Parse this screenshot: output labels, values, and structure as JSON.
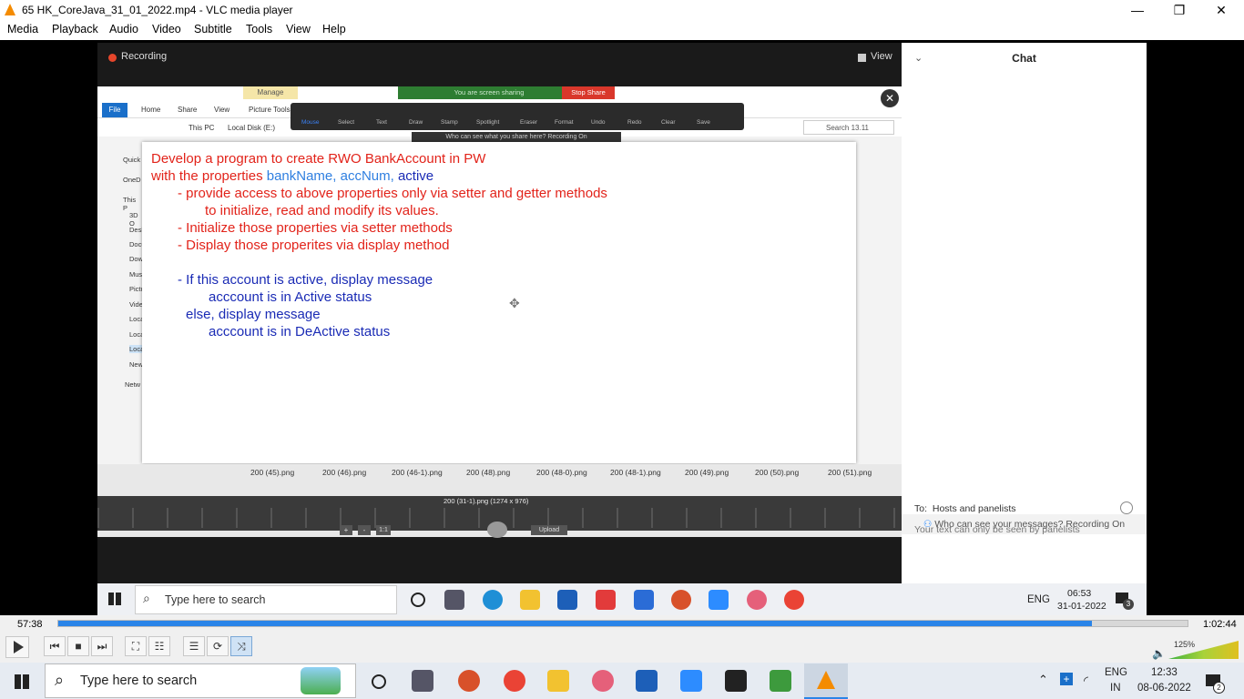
{
  "window": {
    "title": "65 HK_CoreJava_31_01_2022.mp4 - VLC media player",
    "minimize": "—",
    "restore": "❐",
    "close": "✕"
  },
  "menu": [
    "Media",
    "Playback",
    "Audio",
    "Video",
    "Subtitle",
    "Tools",
    "View",
    "Help"
  ],
  "zoom": {
    "recording": "Recording",
    "view": "View",
    "share_status": "You are screen sharing",
    "stop_share": "Stop Share",
    "who_sees": "Who can see what you share here? Recording On",
    "explorer_tabs": [
      "File",
      "Home",
      "Share",
      "View",
      "Picture Tools"
    ],
    "manage": "Manage",
    "path": [
      "This PC",
      "Local Disk (E:)"
    ],
    "search": "Search 13.11",
    "annot_tools": [
      "Mouse",
      "Select",
      "Text",
      "Draw",
      "Stamp",
      "Spotlight",
      "Eraser",
      "Format",
      "Undo",
      "Redo",
      "Clear",
      "Save"
    ],
    "nav_items": [
      "Quick",
      "OneD",
      "This P",
      "3D O",
      "Desk",
      "Docu",
      "Down",
      "Musi",
      "Pictu",
      "Vide",
      "Loca",
      "Loca",
      "Loca",
      "New",
      "Netw"
    ]
  },
  "slide": {
    "line1": "Develop a program to create RWO BankAccount in PW",
    "line2_prefix": "with the properties ",
    "line2_props_a": "bankName, accNum,",
    "line2_props_b": " active",
    "line3": "- provide access to above properties only via setter and getter methods",
    "line4": "to initialize, read and modify its values.",
    "line5": "- Initialize those properties via setter methods",
    "line6": "- Display those properites via display method",
    "line7": "- If this account is active, display message",
    "line8": "acccount is in Active status",
    "line9": "else, display message",
    "line10": "acccount is in DeActive status"
  },
  "filmstrip": {
    "files": [
      "200 (45).png",
      "200 (46).png",
      "200 (46-1).png",
      "200 (48).png",
      "200 (48-0).png",
      "200 (48-1).png",
      "200 (49).png",
      "200 (50).png",
      "200 (51).png"
    ],
    "current": "200 (31-1).png (1274 x 976)",
    "zoom_minus": "-",
    "zoom_plus": "+",
    "ratio": "1:1",
    "upload": "Upload"
  },
  "chat": {
    "header": "Chat",
    "visibility": "Who can see your messages? Recording On",
    "to_label": "To:",
    "to_value": "Hosts and panelists",
    "note": "Your text can only be seen by panelists"
  },
  "inner_taskbar": {
    "search": "Type here to search",
    "lang": "ENG",
    "time": "06:53",
    "date": "31-01-2022",
    "notif_count": "3"
  },
  "player": {
    "elapsed": "57:38",
    "total": "1:02:44",
    "progress": 0.915,
    "volume": "125%"
  },
  "outer_taskbar": {
    "search": "Type here to search",
    "lang_top": "ENG",
    "lang_bottom": "IN",
    "time": "12:33",
    "date": "08-06-2022",
    "notif_count": "2"
  },
  "colors": {
    "vlc_orange": "#f48b00",
    "seek_blue": "#2a84e8",
    "slide_red": "#e2231a",
    "slide_blue": "#1a2bb5",
    "stop_share_red": "#d9372b"
  }
}
